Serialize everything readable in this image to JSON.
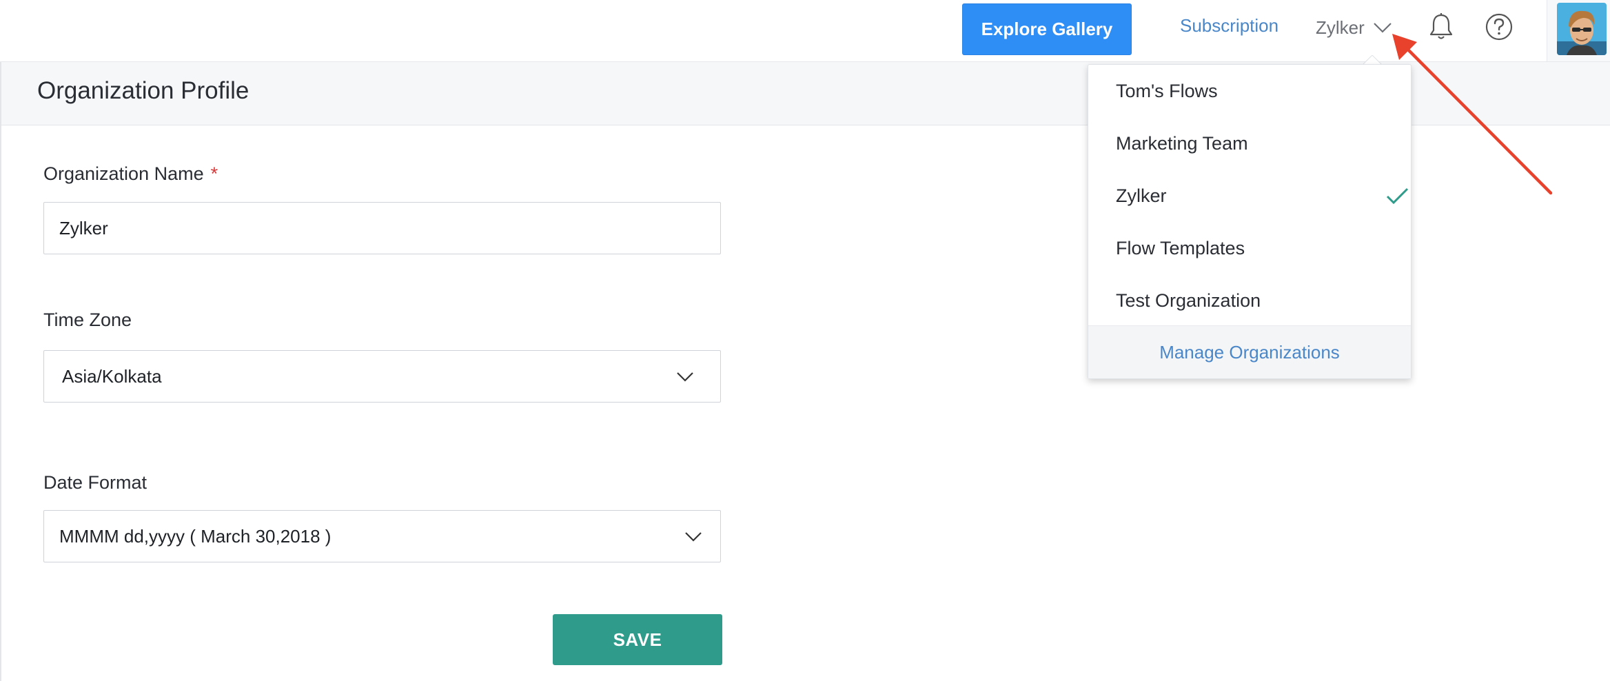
{
  "header": {
    "explore_label": "Explore Gallery",
    "subscription_label": "Subscription",
    "current_org": "Zylker"
  },
  "page": {
    "title": "Organization Profile"
  },
  "form": {
    "org_name_label": "Organization Name",
    "required_mark": "*",
    "org_name_value": "Zylker",
    "timezone_label": "Time Zone",
    "timezone_value": "Asia/Kolkata",
    "date_format_label": "Date Format",
    "date_format_value": "MMMM dd,yyyy ( March 30,2018 )",
    "save_label": "SAVE"
  },
  "dropdown": {
    "items": [
      {
        "label": "Tom's Flows"
      },
      {
        "label": "Marketing Team"
      },
      {
        "label": "Zylker",
        "selected": true
      },
      {
        "label": "Flow Templates"
      },
      {
        "label": "Test Organization"
      }
    ],
    "footer_label": "Manage Organizations"
  },
  "colors": {
    "primary_button": "#2f8ef5",
    "save_button": "#2f9c8b",
    "link": "#4a87c9",
    "check": "#2f9c8b",
    "annotation_arrow": "#e8412c",
    "required": "#d63b3b"
  },
  "icons": [
    "chevron-down-icon",
    "bell-icon",
    "help-icon",
    "check-icon"
  ]
}
